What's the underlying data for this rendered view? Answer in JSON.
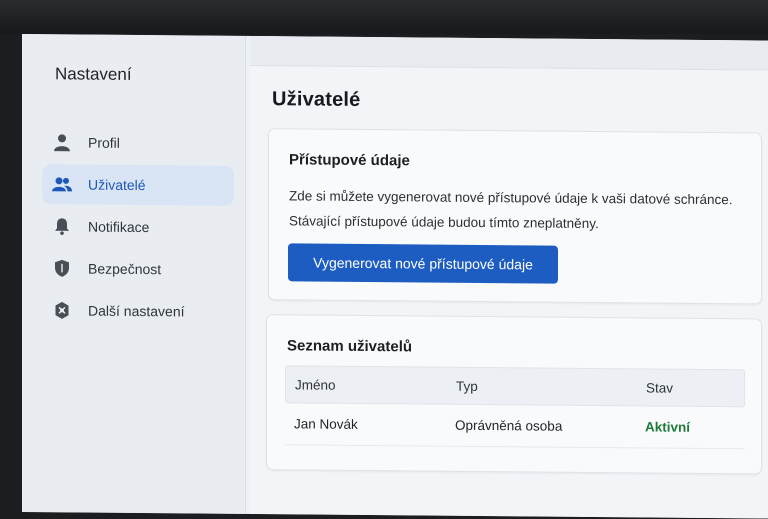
{
  "sidebar": {
    "title": "Nastavení",
    "items": [
      {
        "label": "Profil",
        "icon": "person-icon"
      },
      {
        "label": "Uživatelé",
        "icon": "people-icon",
        "active": true
      },
      {
        "label": "Notifikace",
        "icon": "bell-icon"
      },
      {
        "label": "Bezpečnost",
        "icon": "shield-icon"
      },
      {
        "label": "Další nastavení",
        "icon": "gear-icon"
      }
    ]
  },
  "main": {
    "title": "Uživatelé",
    "credentials": {
      "title": "Přístupové údaje",
      "description_line1": "Zde si můžete vygenerovat nové přístupové údaje k vaši datové schránce.",
      "description_line2": "Stávající přístupové údaje budou tímto zneplatněny.",
      "button_label": "Vygenerovat nové přístupové údaje"
    },
    "users": {
      "title": "Seznam uživatelů",
      "columns": [
        "Jméno",
        "Typ",
        "Stav"
      ],
      "rows": [
        {
          "name": "Jan Novák",
          "type": "Oprávněná osoba",
          "status": "Aktivní"
        }
      ]
    }
  },
  "colors": {
    "accent": "#1d5cc0",
    "active_nav_bg": "#d9e5f4",
    "status_active": "#1f7a3a"
  }
}
